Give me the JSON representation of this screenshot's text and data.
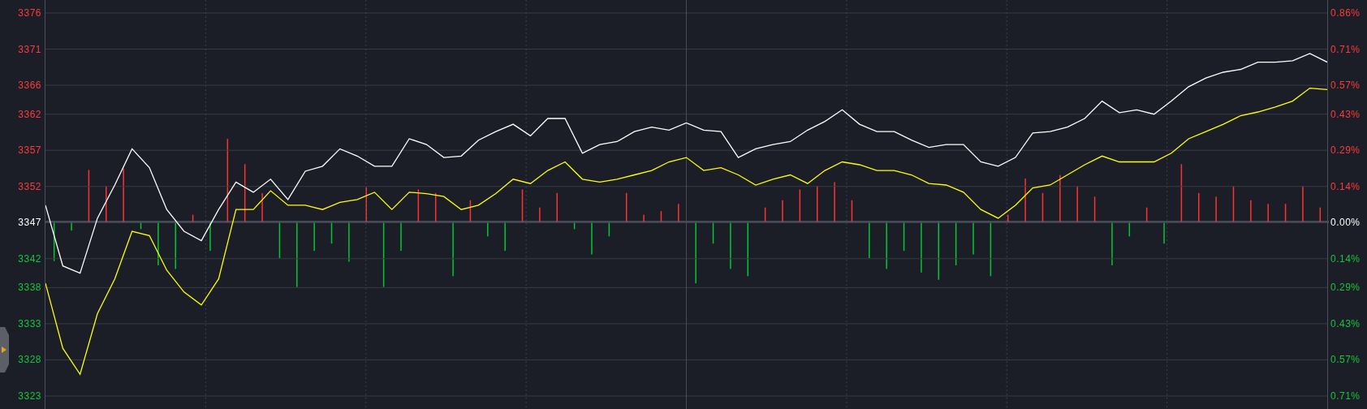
{
  "side_tab": {
    "kind": "collapse"
  },
  "chart": {
    "chart_data": {
      "type": "line",
      "ylim": [
        3323,
        3376
      ],
      "yticks": [
        {
          "value": 3376,
          "label": "3376"
        },
        {
          "value": 3371,
          "label": "3371"
        },
        {
          "value": 3366,
          "label": "3366"
        },
        {
          "value": 3362,
          "label": "3362"
        },
        {
          "value": 3357,
          "label": "3357"
        },
        {
          "value": 3352,
          "label": "3352"
        },
        {
          "value": 3347,
          "label": "3347"
        },
        {
          "value": 3342,
          "label": "3342"
        },
        {
          "value": 3338,
          "label": "3338"
        },
        {
          "value": 3333,
          "label": "3333"
        },
        {
          "value": 3328,
          "label": "3328"
        },
        {
          "value": 3323,
          "label": "3323"
        }
      ],
      "grid": true,
      "series": [
        {
          "color": "#ffffff",
          "values": [
            3349.4,
            3341.0,
            3340.0,
            3347.6,
            3352.2,
            3357.2,
            3354.6,
            3348.8,
            3345.8,
            3344.5,
            3348.8,
            3352.6,
            3351.2,
            3353.0,
            3350.2,
            3354.1,
            3354.8,
            3357.2,
            3356.2,
            3354.8,
            3354.8,
            3358.6,
            3357.8,
            3356.0,
            3356.2,
            3358.4,
            3359.6,
            3360.6,
            3359.0,
            3361.4,
            3361.4,
            3356.6,
            3357.8,
            3358.2,
            3359.6,
            3360.2,
            3359.8,
            3360.8,
            3359.8,
            3359.6,
            3356.0,
            3357.2,
            3357.8,
            3358.2,
            3359.8,
            3361.0,
            3362.6,
            3360.6,
            3359.6,
            3359.6,
            3358.4,
            3357.4,
            3357.8,
            3357.8,
            3355.4,
            3354.8,
            3356.0,
            3359.4,
            3359.6,
            3360.2,
            3361.4,
            3363.8,
            3362.2,
            3362.6,
            3362.0,
            3363.8,
            3365.8,
            3367.0,
            3367.8,
            3368.2,
            3369.2,
            3369.2,
            3369.4,
            3370.4,
            3369.2
          ]
        },
        {
          "color": "#ffff00",
          "values": [
            3338.6,
            3329.6,
            3326.0,
            3334.4,
            3339.2,
            3345.8,
            3345.2,
            3340.4,
            3337.4,
            3335.6,
            3339.2,
            3348.8,
            3348.8,
            3351.4,
            3349.4,
            3349.4,
            3348.8,
            3349.8,
            3350.2,
            3351.2,
            3348.8,
            3351.2,
            3351.0,
            3350.6,
            3348.8,
            3349.4,
            3351.0,
            3353.0,
            3352.4,
            3354.2,
            3355.4,
            3353.0,
            3352.6,
            3353.0,
            3353.6,
            3354.2,
            3355.4,
            3356.0,
            3354.2,
            3354.6,
            3353.6,
            3352.2,
            3353.0,
            3353.6,
            3352.4,
            3354.2,
            3355.4,
            3355.0,
            3354.2,
            3354.2,
            3353.6,
            3352.4,
            3352.2,
            3351.2,
            3348.8,
            3347.6,
            3349.4,
            3351.8,
            3352.2,
            3353.6,
            3355.0,
            3356.2,
            3355.4,
            3355.4,
            3355.4,
            3356.6,
            3358.6,
            3359.6,
            3360.6,
            3361.8,
            3362.3,
            3363.0,
            3363.8,
            3365.6,
            3365.4
          ]
        }
      ]
    },
    "percent_axis": [
      {
        "label": "0.86%",
        "color": "#ff3b3b"
      },
      {
        "label": "0.71%",
        "color": "#ff3b3b"
      },
      {
        "label": "0.57%",
        "color": "#ff3b3b"
      },
      {
        "label": "0.43%",
        "color": "#ff3b3b"
      },
      {
        "label": "0.29%",
        "color": "#ff3b3b"
      },
      {
        "label": "0.14%",
        "color": "#ff3b3b"
      },
      {
        "label": "0.00%",
        "color": "#ffffff"
      },
      {
        "label": "0.14%",
        "color": "#14c83c"
      },
      {
        "label": "0.29%",
        "color": "#14c83c"
      },
      {
        "label": "0.43%",
        "color": "#14c83c"
      },
      {
        "label": "0.57%",
        "color": "#14c83c"
      },
      {
        "label": "0.71%",
        "color": "#14c83c"
      }
    ]
  }
}
